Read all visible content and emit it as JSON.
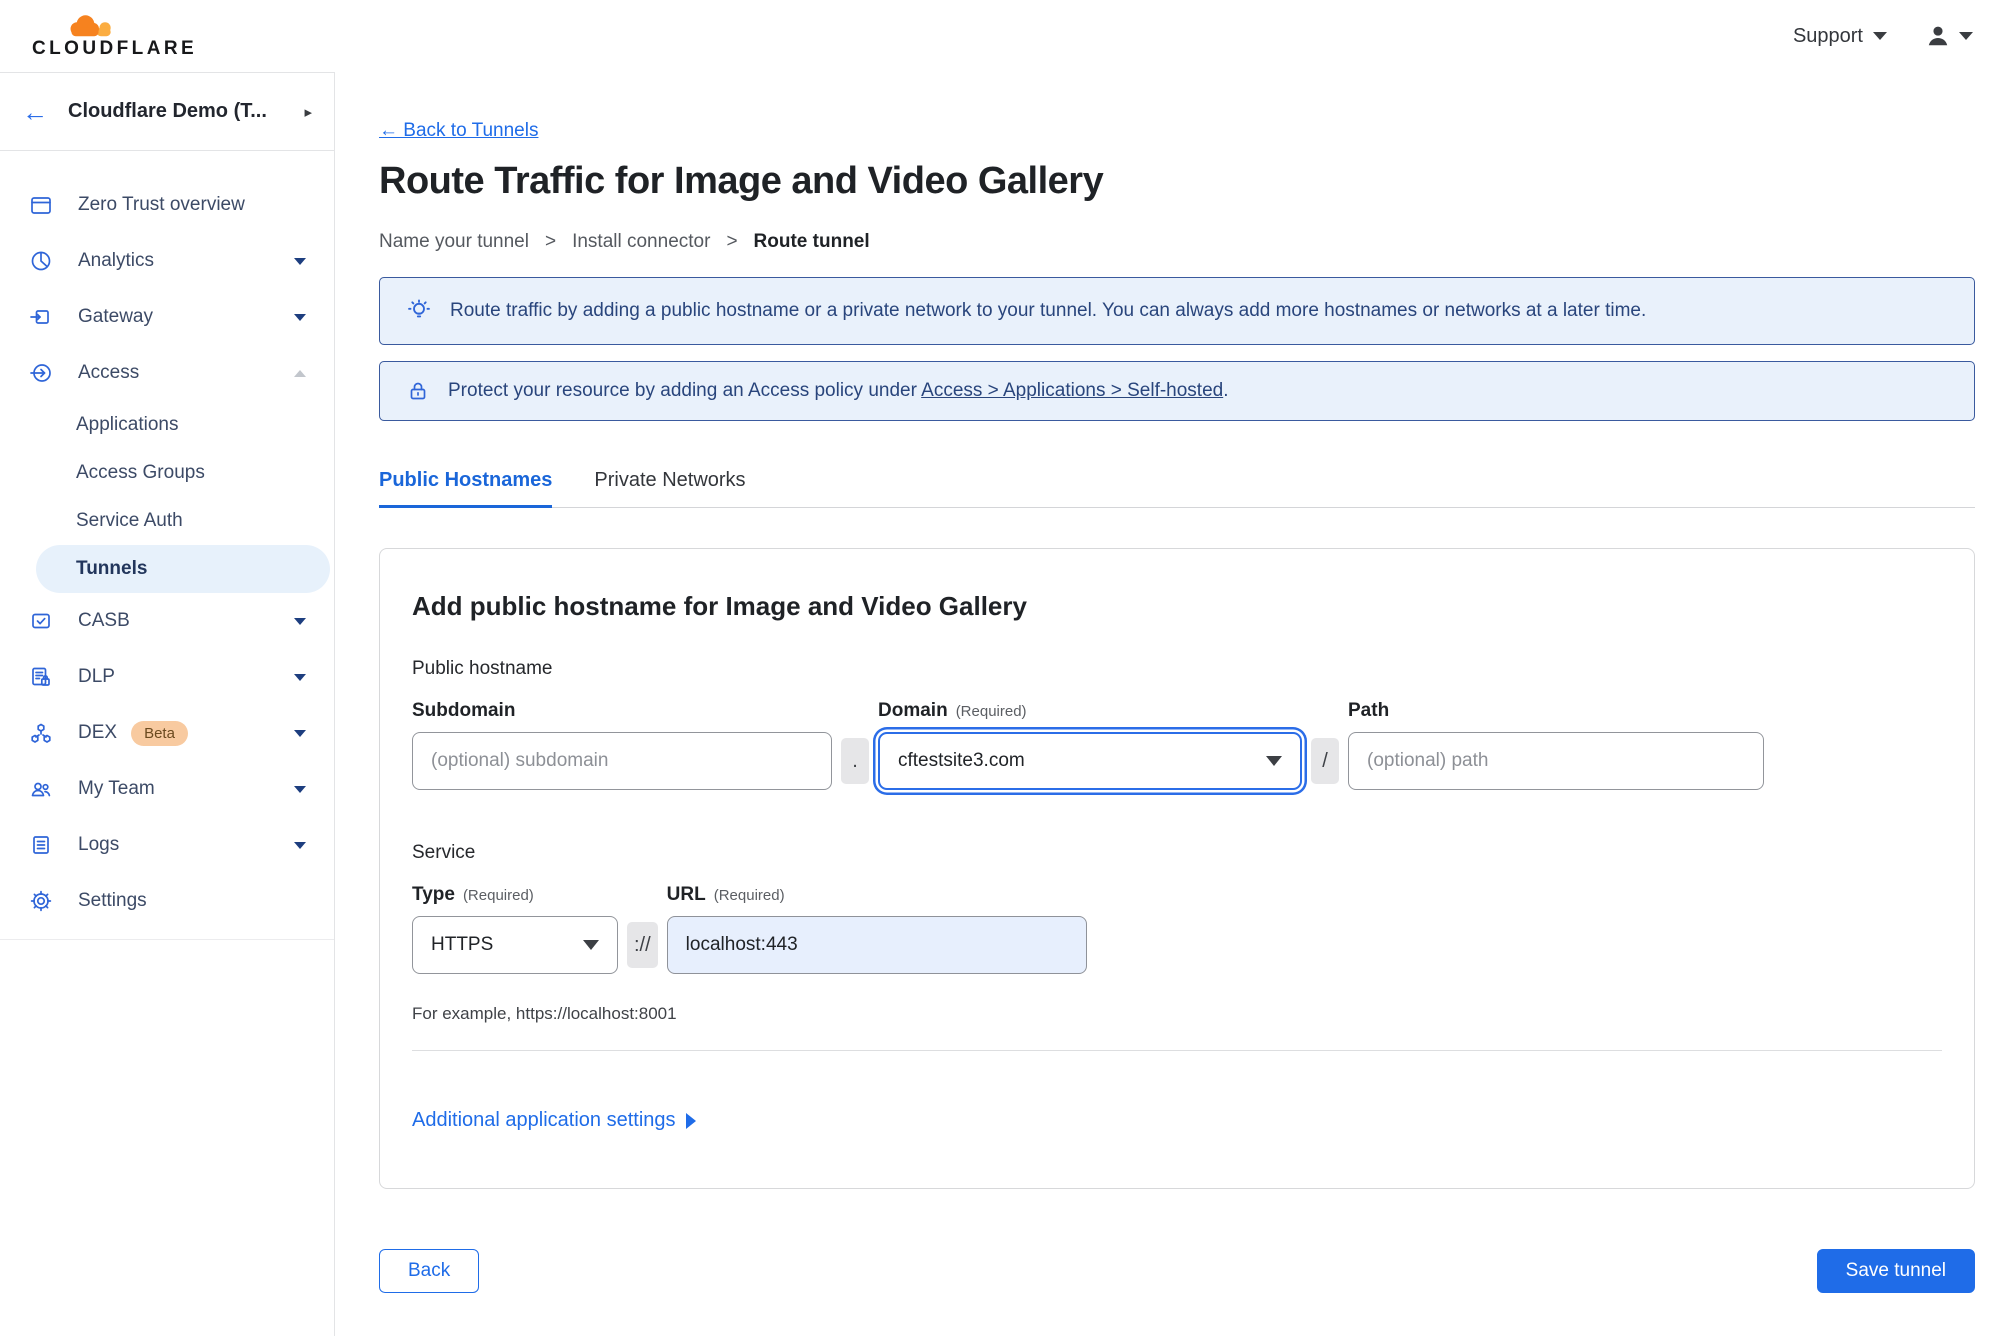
{
  "colors": {
    "accent_blue": "#1f6ce8",
    "tab_active_blue": "#1a66d9",
    "sidebar_icon_blue": "#2f65d8",
    "banner_bg": "#e9f1fb",
    "banner_border": "#3a5a9e",
    "banner_text": "#29457c",
    "active_item_bg": "#e7f1fb",
    "url_field_bg": "#e7effd",
    "beta_badge_bg": "#f8caa0",
    "logo_orange": "#f6821f",
    "logo_light_orange": "#fbad41"
  },
  "header": {
    "logo_text": "CLOUDFLARE",
    "support_label": "Support"
  },
  "sidebar": {
    "back_arrow": "←",
    "account": "Cloudflare Demo (T...",
    "expander": "▸",
    "items": [
      {
        "label": "Zero Trust overview"
      },
      {
        "label": "Analytics"
      },
      {
        "label": "Gateway"
      },
      {
        "label": "Access"
      },
      {
        "label": "Applications"
      },
      {
        "label": "Access Groups"
      },
      {
        "label": "Service Auth"
      },
      {
        "label": "Tunnels"
      },
      {
        "label": "CASB"
      },
      {
        "label": "DLP"
      },
      {
        "label": "DEX",
        "badge": "Beta"
      },
      {
        "label": "My Team"
      },
      {
        "label": "Logs"
      },
      {
        "label": "Settings"
      }
    ]
  },
  "main": {
    "back_link": "← Back to Tunnels",
    "title": "Route Traffic for Image and Video Gallery",
    "step_separator": ">",
    "steps": [
      "Name your tunnel",
      "Install connector",
      "Route tunnel"
    ],
    "banners": [
      {
        "icon": "lightbulb-icon",
        "text": "Route traffic by adding a public hostname or a private network to your tunnel. You can always add more hostnames or networks at a later time."
      },
      {
        "icon": "lock-icon",
        "text_before": "Protect your resource by adding an Access policy under ",
        "link_label": "Access > Applications > Self-hosted",
        "text_after": "."
      }
    ],
    "tabs": [
      {
        "label": "Public Hostnames",
        "active": true
      },
      {
        "label": "Private Networks",
        "active": false
      }
    ],
    "card": {
      "heading": "Add public hostname for Image and Video Gallery",
      "public_hostname_label": "Public hostname",
      "required_tag": "(Required)",
      "separators": {
        "dot": ".",
        "slash": "/",
        "scheme": "://"
      },
      "subdomain": {
        "label": "Subdomain",
        "placeholder": "(optional) subdomain",
        "value": ""
      },
      "domain": {
        "label": "Domain",
        "value": "cftestsite3.com"
      },
      "path": {
        "label": "Path",
        "placeholder": "(optional) path",
        "value": ""
      },
      "service_label": "Service",
      "type": {
        "label": "Type",
        "value": "HTTPS"
      },
      "url": {
        "label": "URL",
        "value": "localhost:443"
      },
      "example_text": "For example, https://localhost:8001",
      "additional_settings_label": "Additional application settings"
    },
    "footer": {
      "back_label": "Back",
      "save_label": "Save tunnel"
    }
  }
}
